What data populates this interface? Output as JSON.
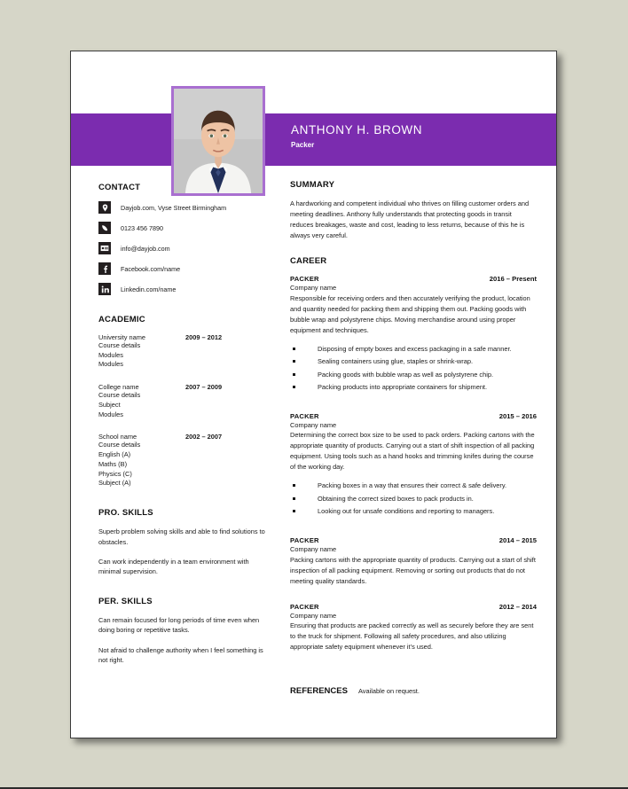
{
  "header": {
    "name": "ANTHONY H. BROWN",
    "role": "Packer",
    "accent_color": "#7b2caf",
    "photo_border_color": "#a96fd0",
    "photo_alt": "headshot-photo"
  },
  "contact": {
    "heading": "CONTACT",
    "items": [
      {
        "icon": "location-pin-icon",
        "text": "Dayjob.com, Vyse Street Birmingham"
      },
      {
        "icon": "phone-icon",
        "text": "0123 456 7890"
      },
      {
        "icon": "email-icon",
        "text": "info@dayjob.com"
      },
      {
        "icon": "facebook-icon",
        "text": "Facebook.com/name"
      },
      {
        "icon": "linkedin-icon",
        "text": "Linkedin.com/name"
      }
    ]
  },
  "academic": {
    "heading": "ACADEMIC",
    "items": [
      {
        "institution": "University name",
        "dates": "2009 – 2012",
        "lines": [
          "Course details",
          "Modules",
          "Modules"
        ]
      },
      {
        "institution": "College name",
        "dates": "2007 – 2009",
        "lines": [
          "Course details",
          "Subject",
          "Modules"
        ]
      },
      {
        "institution": "School name",
        "dates": "2002 – 2007",
        "lines": [
          "Course details",
          "English (A)",
          "Maths (B)",
          "Physics (C)",
          "Subject (A)"
        ]
      }
    ]
  },
  "pro_skills": {
    "heading": "PRO. SKILLS",
    "items": [
      "Superb problem solving skills and able to find solutions to obstacles.",
      "Can work independently in a team environment with minimal supervision."
    ]
  },
  "per_skills": {
    "heading": "PER. SKILLS",
    "items": [
      "Can remain focused for long periods of time even when doing boring or repetitive tasks.",
      "Not afraid to challenge authority when I feel something is not right."
    ]
  },
  "summary": {
    "heading": "SUMMARY",
    "text": "A hardworking and competent individual who thrives on filling customer orders and meeting deadlines. Anthony fully understands that protecting goods in transit reduces breakages, waste and cost, leading to less returns, because of this he is always very careful."
  },
  "career": {
    "heading": "CAREER",
    "jobs": [
      {
        "title": "PACKER",
        "dates": "2016 – Present",
        "company": "Company name",
        "description": "Responsible for receiving orders and then accurately verifying the product, location and quantity needed for packing them and shipping them out. Packing goods with bubble wrap and polystyrene chips. Moving merchandise around using proper equipment and techniques.",
        "duties": [
          "Disposing of empty boxes and excess packaging in a safe manner.",
          "Sealing containers using glue, staples or shrink-wrap.",
          "Packing goods with bubble wrap as well as polystyrene chip.",
          "Packing products into appropriate containers for shipment."
        ]
      },
      {
        "title": "PACKER",
        "dates": "2015 – 2016",
        "company": "Company name",
        "description": "Determining the correct box size to be used to pack orders. Packing cartons with the appropriate quantity of products. Carrying out a start of shift inspection of all packing equipment. Using tools such as a hand hooks and trimming knifes during the course of the working day.",
        "duties": [
          "Packing boxes in a way that ensures their correct & safe delivery.",
          "Obtaining the correct sized boxes to pack products in.",
          "Looking out for unsafe conditions and reporting to managers."
        ]
      },
      {
        "title": "PACKER",
        "dates": "2014 – 2015",
        "company": "Company name",
        "description": "Packing cartons with the appropriate quantity of products. Carrying out a start of shift inspection of all packing equipment. Removing or sorting out products that do not meeting quality standards.",
        "duties": []
      },
      {
        "title": "PACKER",
        "dates": "2012 – 2014",
        "company": "Company name",
        "description": "Ensuring that products are packed correctly as well as securely before they are sent to the truck for shipment. Following all safety procedures, and also utilizing appropriate safety equipment whenever it’s used.",
        "duties": []
      }
    ]
  },
  "references": {
    "heading": "REFERENCES",
    "text": "Available on request."
  }
}
